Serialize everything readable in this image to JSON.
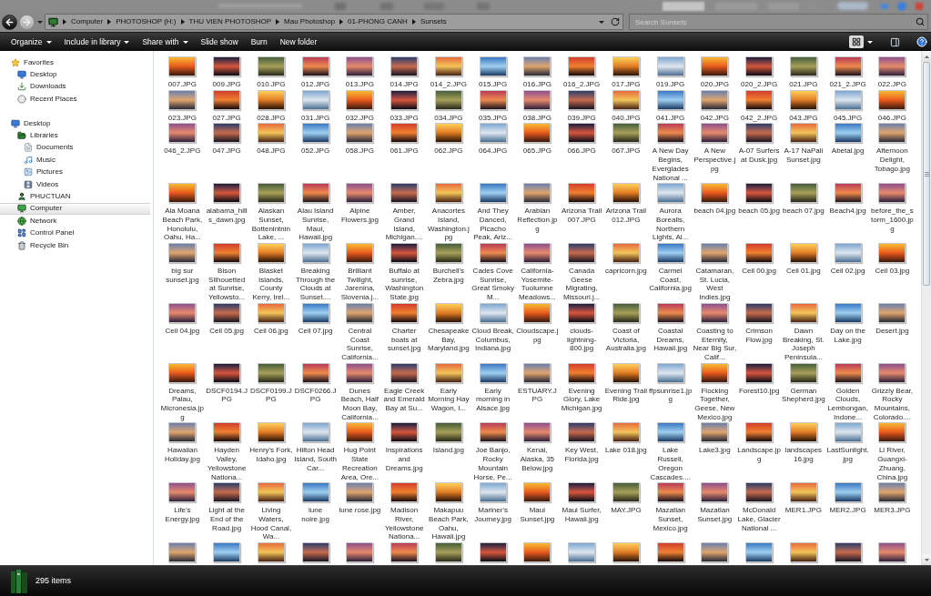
{
  "nav_buttons": [
    {
      "kind": "back",
      "disabled": false
    },
    {
      "kind": "forward",
      "disabled": true
    }
  ],
  "address_bar": {
    "breadcrumbs": [
      "Computer",
      "PHOTOSHOP (H:)",
      "THU VIEN PHOTOSHOP",
      "Mau Photoshop",
      "01-PHONG CANH",
      "Sunsets"
    ]
  },
  "search": {
    "placeholder": "Search Sunsets"
  },
  "command_bar": {
    "items": [
      {
        "label": "Organize",
        "dropdown": true
      },
      {
        "label": "Include in library",
        "dropdown": true
      },
      {
        "label": "Share with",
        "dropdown": true
      },
      {
        "label": "Slide show",
        "dropdown": false
      },
      {
        "label": "Burn",
        "dropdown": false
      },
      {
        "label": "New folder",
        "dropdown": false
      }
    ]
  },
  "navigation_pane": {
    "items": [
      {
        "kind": "favorites",
        "label": "Favorites",
        "selected": false,
        "children": [
          {
            "kind": "desktop",
            "label": "Desktop",
            "selected": false
          },
          {
            "kind": "downloads",
            "label": "Downloads",
            "selected": false
          },
          {
            "kind": "recent",
            "label": "Recent Places",
            "selected": false
          }
        ]
      },
      {
        "kind": "desktop",
        "label": "Desktop",
        "selected": false,
        "children": [
          {
            "kind": "libraries",
            "label": "Libraries",
            "selected": false,
            "children": [
              {
                "kind": "documents",
                "label": "Documents",
                "selected": false
              },
              {
                "kind": "music",
                "label": "Music",
                "selected": false
              },
              {
                "kind": "pictures",
                "label": "Pictures",
                "selected": false
              },
              {
                "kind": "videos",
                "label": "Videos",
                "selected": false
              }
            ]
          },
          {
            "kind": "user",
            "label": "PHUCTUAN",
            "selected": false
          },
          {
            "kind": "computer",
            "label": "Computer",
            "selected": true
          },
          {
            "kind": "network",
            "label": "Network",
            "selected": false
          },
          {
            "kind": "control_panel",
            "label": "Control Panel",
            "selected": false
          },
          {
            "kind": "recycle_bin",
            "label": "Recycle Bin",
            "selected": false
          }
        ]
      }
    ]
  },
  "files": [
    "007.JPG",
    "009.JPG",
    "010.JPG",
    "012.JPG",
    "013.JPG",
    "014.JPG",
    "014_2.JPG",
    "015.JPG",
    "016.JPG",
    "016_2.JPG",
    "017.JPG",
    "019.JPG",
    "020.JPG",
    "020_2.JPG",
    "021.JPG",
    "021_2.JPG",
    "022.JPG",
    "023.JPG",
    "027.JPG",
    "028.JPG",
    "031.JPG",
    "032.JPG",
    "033.JPG",
    "034.JPG",
    "035.JPG",
    "038.JPG",
    "039.JPG",
    "040.JPG",
    "041.JPG",
    "042.JPG",
    "042_2.JPG",
    "043.JPG",
    "045.JPG",
    "046.JPG",
    "046_2.JPG",
    "047.JPG",
    "048.JPG",
    "052.JPG",
    "058.JPG",
    "061.JPG",
    "062.JPG",
    "064.JPG",
    "065.JPG",
    "066.JPG",
    "067.JPG",
    "A New Day Begins, Everglades National ...",
    "A New Perspective.jpg",
    "A-07 Surfers at Dusk.jpg",
    "A-17 NaPali Sunset.jpg",
    "Abetal.jpg",
    "Afternoon Delight, Tobago.jpg",
    "Ala Moana Beach Park, Honolulu, Oahu, Ha...",
    "alabama_hills_dawn.jpg",
    "Alaskan Sunset, Bottenintnin Lake, ...",
    "Alau Island Sunrise, Maui, Hawaii.jpg",
    "Alpine Flowers.jpg",
    "Amber, Grand Island, Michigan....",
    "Anacortes Island, Washington.jpg",
    "And They Danced, Picacho Peak, Ariz...",
    "Arabian Reflection.jpg",
    "Arizona Trail 007.JPG",
    "Arizona Trail 012.JPG",
    "Aurora Borealis, Northern Lights, Al...",
    "beach 04.jpg",
    "beach 05.jpg",
    "beach 07.jpg",
    "Beach4.jpg",
    "before_the_storm_1600.jpg",
    "big sur sunset.jpg",
    "Bison Silhouetted at Sunrise, Yellowsto...",
    "Blasket Islands, County Kerry, Irel...",
    "Breaking Through the Clouds at Sunset....",
    "Brilliant Twilight, Jarenina, Slovenia.j...",
    "Buffalo at sunrise, Washington State.jpg",
    "Burchell's Zebra.jpg",
    "Cades Cove Sunrise, Great Smoky M...",
    "California-Yosemite-Tuolumne Meadows...",
    "Canada Geese Migrating, Missouri.j...",
    "capricorn.jpg",
    "Carmel Coast, California.jpg",
    "Catamaran, St. Lucia, West Indies.jpg",
    "Ceil 00.jpg",
    "Ceil 01.jpg",
    "Ceil 02.jpg",
    "Ceil 03.jpg",
    "Ceil 04.jpg",
    "Ceil 05.jpg",
    "Ceil 06.jpg",
    "Ceil 07.jpg",
    "Central Coast Sunrise, California...",
    "Charter boats at sunset.jpg",
    "Chesapeake Bay, Maryland.jpg",
    "Cloud Break, Columbus, Indiana.jpg",
    "Cloudscape.jpg",
    "clouds-lightning-800.jpg",
    "Coast of Victoria, Australia.jpg",
    "Coastal Dreams, Hawaii.jpg",
    "Coasting to Eternity, Near Big Sur, Calif...",
    "Crimson Flow.jpg",
    "Dawn Breaking, St. Joseph Peninsula...",
    "Day on the Lake.jpg",
    "Desert.jpg",
    "Dreams, Palau, Micronesia.jpg",
    "DSCF0194.JPG",
    "DSCF0199.JPG",
    "DSCF0266.JPG",
    "Dunes Beach, Half Moon Bay, California...",
    "Eagle Creek and Emerald Bay at Su...",
    "Early Morning Hay Wagon, I...",
    "Early morning in Alsace.jpg",
    "ESTUARY.JPG",
    "Evening Glory, Lake Michigan.jpg",
    "Evening Trail Ride.jpg",
    "ffpsunrise1.jpg",
    "Flocking Together, Geese, New Mexico.jpg",
    "Forest10.jpg",
    "German Shepherd.jpg",
    "Golden Clouds, Lembongan, Indone...",
    "Grizzly Bear, Rocky Mountains, Colorado....",
    "Hawaiian Holiday.jpg",
    "Hayden Valley, Yellowstone Nationa...",
    "Henry's Fork, Idaho.jpg",
    "Hilton Head Island, South Car...",
    "Hug Point State Recreation Area, Ore...",
    "Inspirations and Dreams.jpg",
    "Island.jpg",
    "Joe Banjo, Rocky Mountain Horse, Pe...",
    "Kenai, Alaska, 35 Below.jpg",
    "Key West, Florida.jpg",
    "Lake 018.jpg",
    "Lake Russell, Oregon Cascades....",
    "Lake3.jpg",
    "Landscape.jpg",
    "landscapes 16.jpg",
    "LastSunlight.jpg",
    "Li River, Guangxi-Zhuang, China.jpg",
    "Life's Energy.jpg",
    "Light at the End of the Road.jpg",
    "Living Waters, Hood Canal, Wa...",
    "lune noire.jpg",
    "lune rose.jpg",
    "Madison River, Yellowstone Nationa...",
    "Makapuu Beach Park, Oahu, Hawaii.jpg",
    "Mariner's Journey.jpg",
    "Maui Sunset.jpg",
    "Maui Surfer, Hawaii.jpg",
    "MAY.JPG",
    "Mazatlan Sunset, Mexico.jpg",
    "Mazatlan Sunset.jpg",
    "McDonald Lake, Glacier National ...",
    "MER1.JPG",
    "MER2.JPG",
    "MER3.JPG"
  ],
  "status_bar": {
    "item_count": "295 items"
  }
}
